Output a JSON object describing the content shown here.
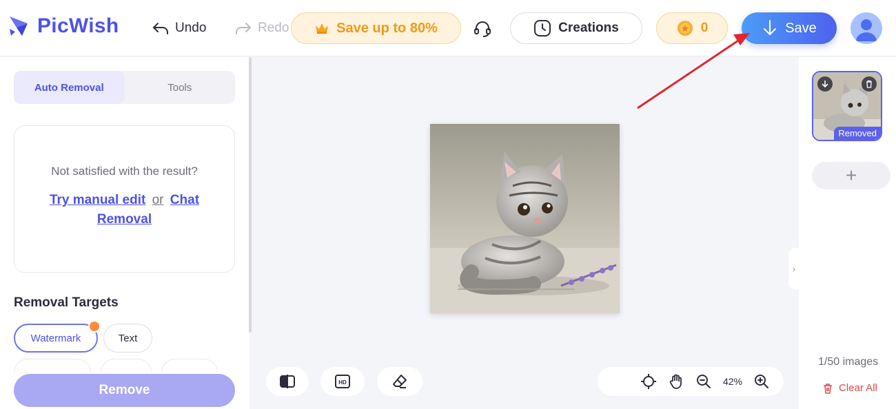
{
  "brand": {
    "name": "PicWish"
  },
  "header": {
    "undo_label": "Undo",
    "redo_label": "Redo",
    "promo_label": "Save up to 80%",
    "creations_label": "Creations",
    "coins_count": "0",
    "save_label": "Save"
  },
  "left_panel": {
    "tabs": [
      {
        "label": "Auto Removal",
        "active": true
      },
      {
        "label": "Tools",
        "active": false
      }
    ],
    "card": {
      "question": "Not satisfied with the result?",
      "manual_edit_link": "Try manual edit",
      "or_text": "or",
      "chat_removal_link": "Chat Removal"
    },
    "targets_title": "Removal Targets",
    "targets": [
      {
        "label": "Watermark",
        "selected": true
      },
      {
        "label": "Text",
        "selected": false
      }
    ],
    "remove_label": "Remove"
  },
  "canvas": {
    "zoom_level": "42%"
  },
  "right_panel": {
    "thumbnail_badge": "Removed",
    "image_count": "1/50 images",
    "clear_all_label": "Clear All"
  },
  "colors": {
    "brand": "#4b53e6",
    "save_gradient_start": "#4b9cf7",
    "save_gradient_end": "#4d62ee",
    "promo": "#f09a18",
    "danger": "#e2474b",
    "annotation_arrow": "#e0262f"
  },
  "icons": [
    "logo-icon",
    "undo-icon",
    "redo-icon",
    "crown-icon",
    "headset-icon",
    "clock-icon",
    "coin-icon",
    "download-icon",
    "user-icon",
    "compare-icon",
    "hd-icon",
    "eraser-icon",
    "crosshair-icon",
    "hand-icon",
    "zoom-out-icon",
    "zoom-in-icon",
    "chevron-right-icon",
    "trash-icon",
    "plus-icon"
  ]
}
